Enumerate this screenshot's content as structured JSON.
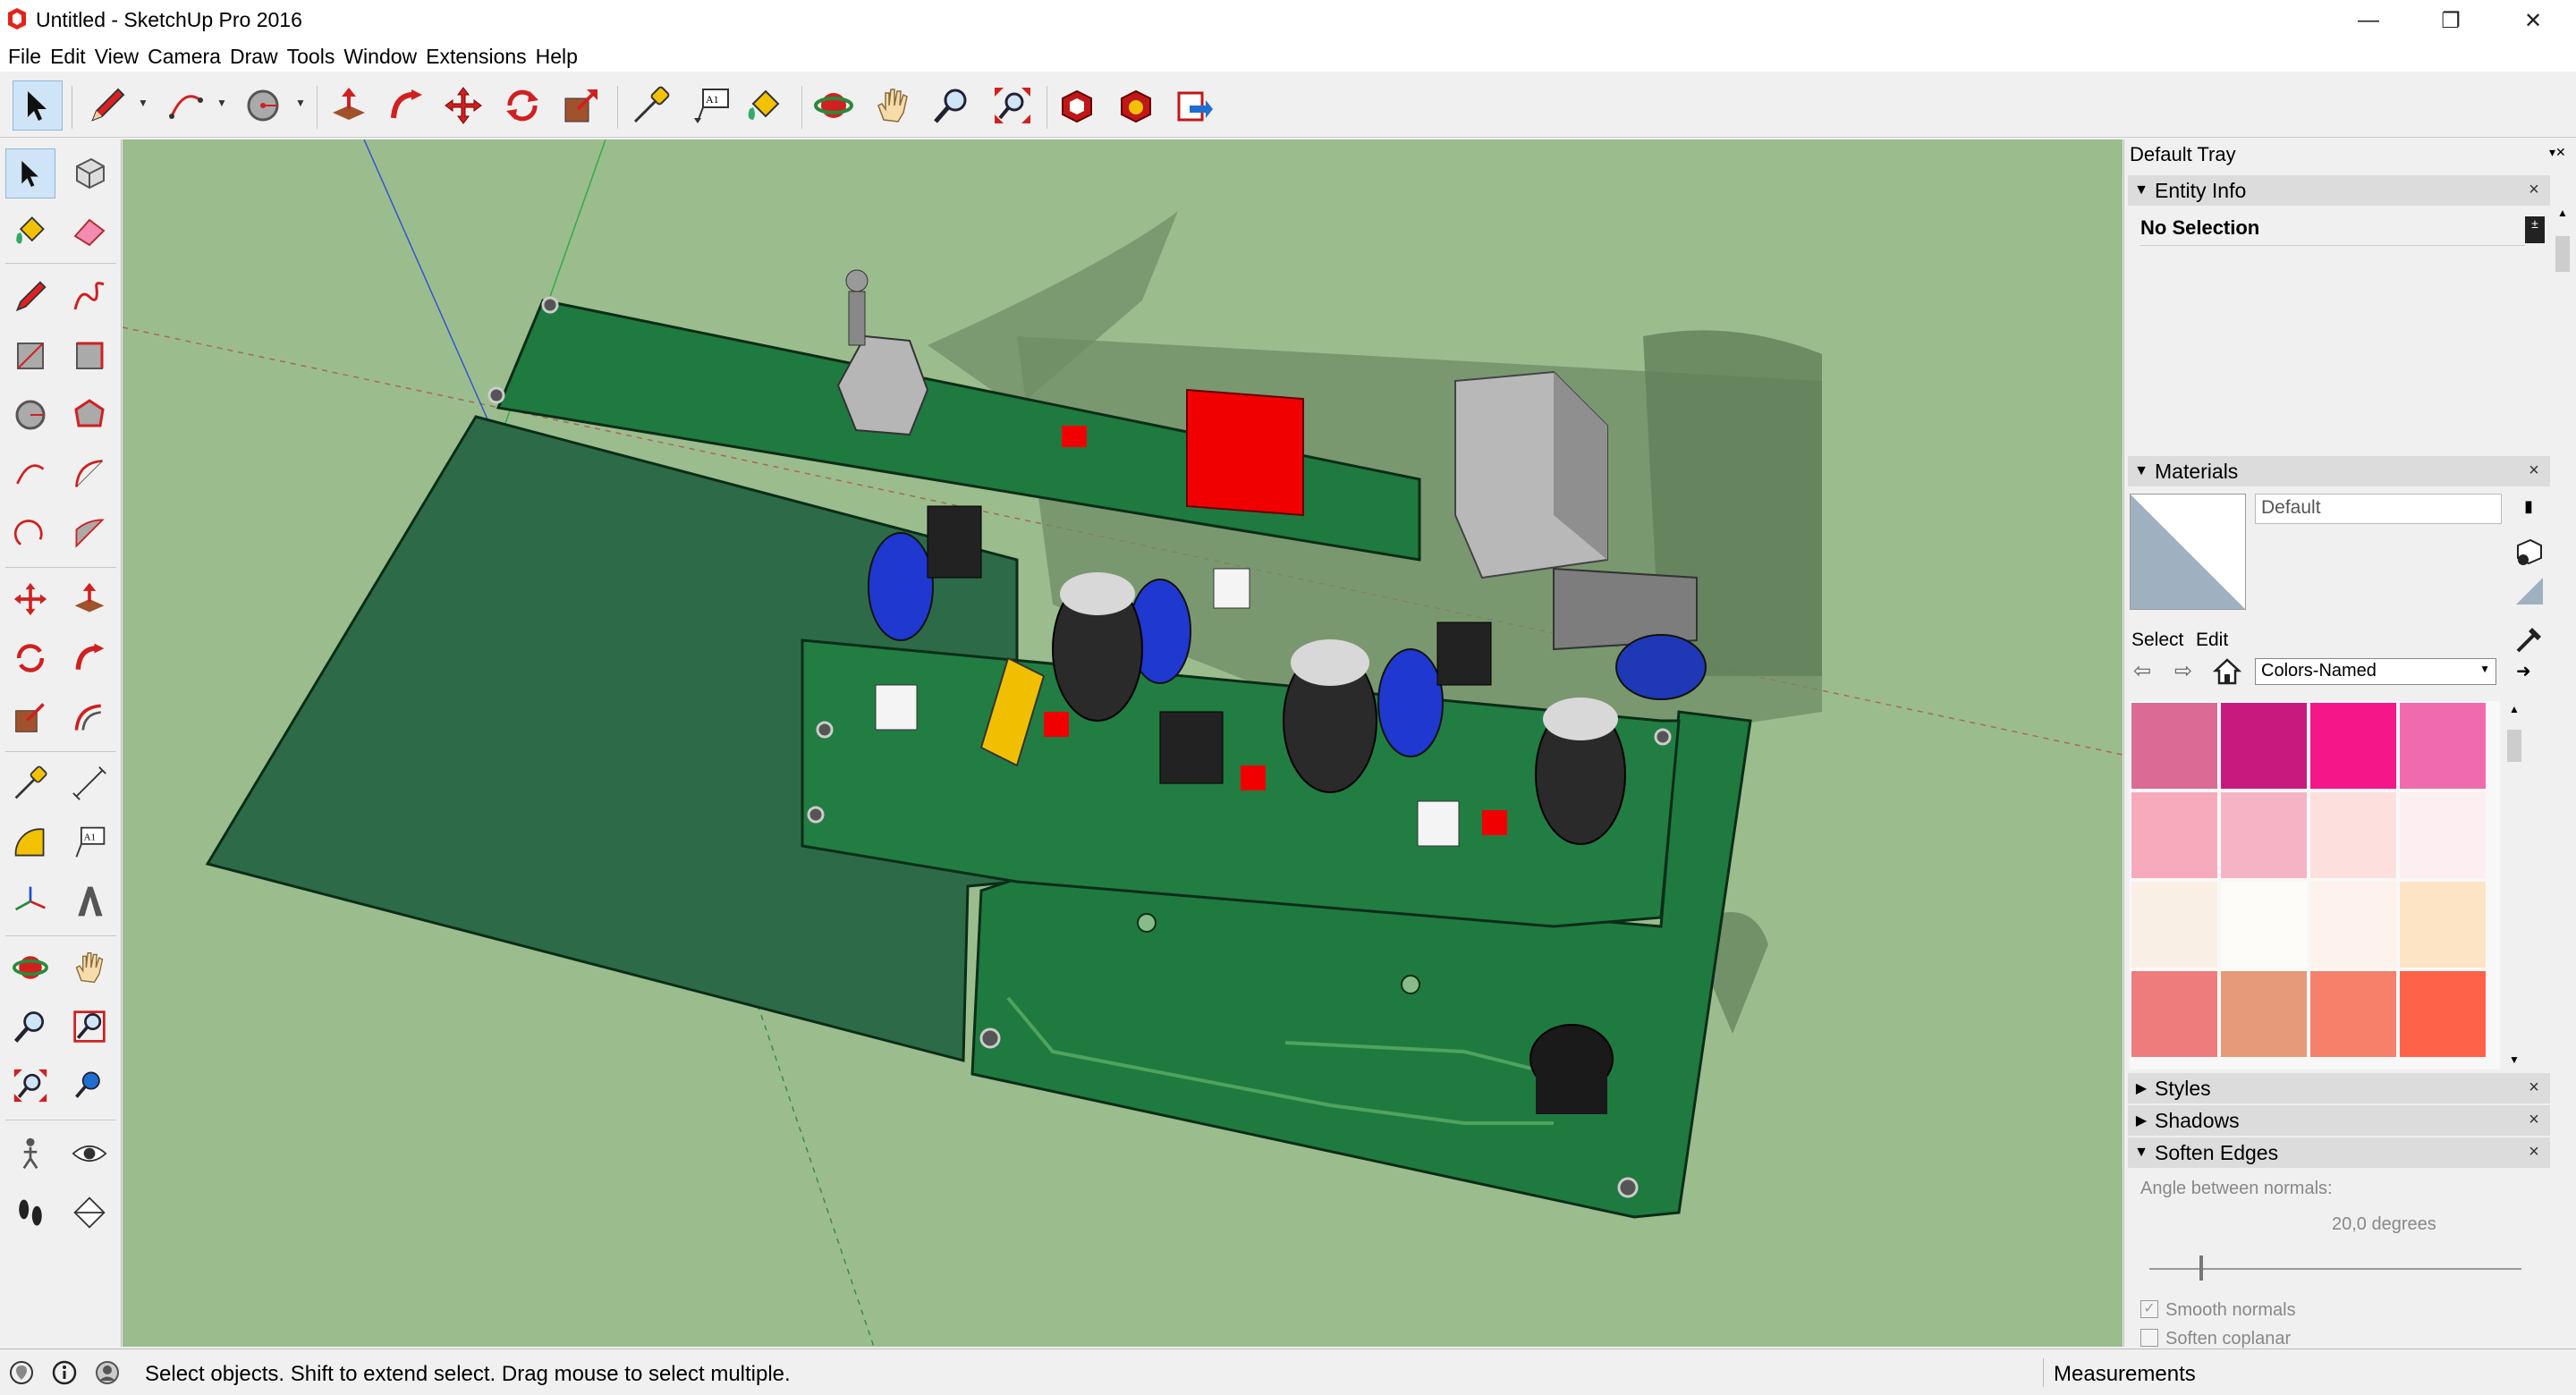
{
  "window": {
    "title": "Untitled - SketchUp Pro 2016",
    "controls": [
      "—",
      "❐",
      "✕"
    ]
  },
  "menu": [
    "File",
    "Edit",
    "View",
    "Camera",
    "Draw",
    "Tools",
    "Window",
    "Extensions",
    "Help"
  ],
  "tray": {
    "title": "Default Tray",
    "entity_info": {
      "header": "Entity Info",
      "selection": "No Selection"
    },
    "materials": {
      "header": "Materials",
      "current_name": "Default",
      "tab_select": "Select",
      "tab_edit": "Edit",
      "library": "Colors-Named",
      "swatches": [
        "#db6b94",
        "#c81a7e",
        "#f5168a",
        "#f06ab0",
        "#f8aabd",
        "#f5b4c6",
        "#fde0dd",
        "#fdeff1",
        "#faefe4",
        "#fefcf9",
        "#fef2ec",
        "#fde4c4",
        "#ef7c7c",
        "#e69a7a",
        "#f7806b",
        "#fe6248"
      ]
    },
    "styles": {
      "header": "Styles"
    },
    "shadows": {
      "header": "Shadows"
    },
    "soften_edges": {
      "header": "Soften Edges",
      "angle_label": "Angle between normals:",
      "angle_value": "20,0  degrees",
      "smooth_label": "Smooth normals",
      "coplanar_label": "Soften coplanar"
    }
  },
  "status": {
    "message": "Select objects. Shift to extend select. Drag mouse to select multiple.",
    "measurements": "Measurements"
  },
  "colors": {
    "viewport_bg": "#9bbd8e",
    "pcb": "#1f7a3f",
    "pcb_dark": "#2d6b48",
    "selected_tool": "#cfe4f7"
  }
}
